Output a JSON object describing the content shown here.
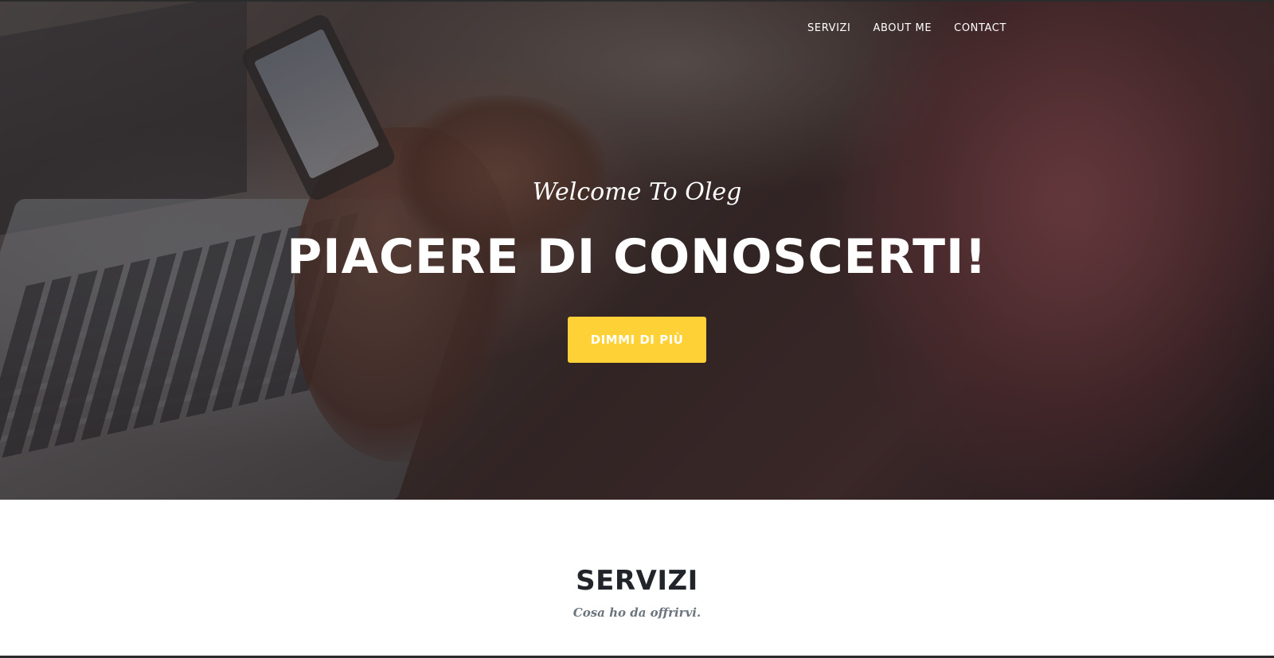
{
  "nav": {
    "items": [
      {
        "label": "SERVIZI"
      },
      {
        "label": "ABOUT ME"
      },
      {
        "label": "CONTACT"
      }
    ]
  },
  "hero": {
    "lead": "Welcome To Oleg",
    "heading": "PIACERE DI CONOSCERTI!",
    "button_label": "DIMMI DI PIÙ"
  },
  "services": {
    "heading": "SERVIZI",
    "subheading": "Cosa ho da offrirvi."
  },
  "colors": {
    "accent": "#fed136",
    "heading_text": "#212529",
    "muted_text": "#6c757d"
  }
}
